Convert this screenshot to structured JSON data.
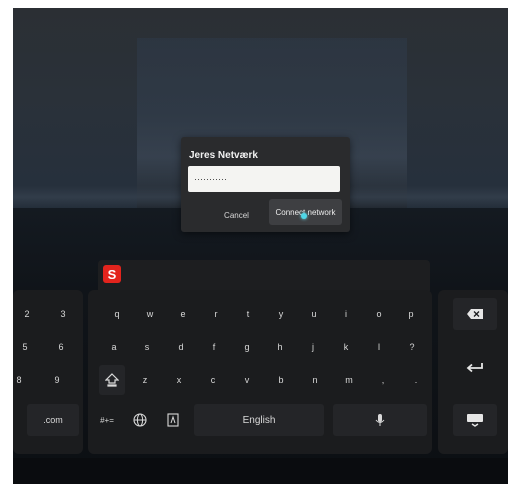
{
  "dialog": {
    "title": "Jeres Netværk",
    "password_mask": "···········",
    "cancel_label": "Cancel",
    "connect_label": "Connect network"
  },
  "keyboard": {
    "logo_letter": "S",
    "left_rows": [
      [
        "2",
        "3"
      ],
      [
        "5",
        "6"
      ],
      [
        "8",
        "9"
      ]
    ],
    "left_com": ".com",
    "rows": [
      [
        "q",
        "w",
        "e",
        "r",
        "t",
        "y",
        "u",
        "i",
        "o",
        "p"
      ],
      [
        "a",
        "s",
        "d",
        "f",
        "g",
        "h",
        "j",
        "k",
        "l",
        "?"
      ],
      [
        "z",
        "x",
        "c",
        "v",
        "b",
        "n",
        "m",
        ",",
        "."
      ]
    ],
    "symbols_label": "#+=",
    "space_label": "English",
    "colors": {
      "logo": "#e3241d",
      "cursor": "#4fd6e6"
    },
    "icons": [
      "shift-icon",
      "globe-icon",
      "clipboard-icon",
      "microphone-icon",
      "backspace-icon",
      "enter-icon",
      "hide-keyboard-icon"
    ]
  }
}
